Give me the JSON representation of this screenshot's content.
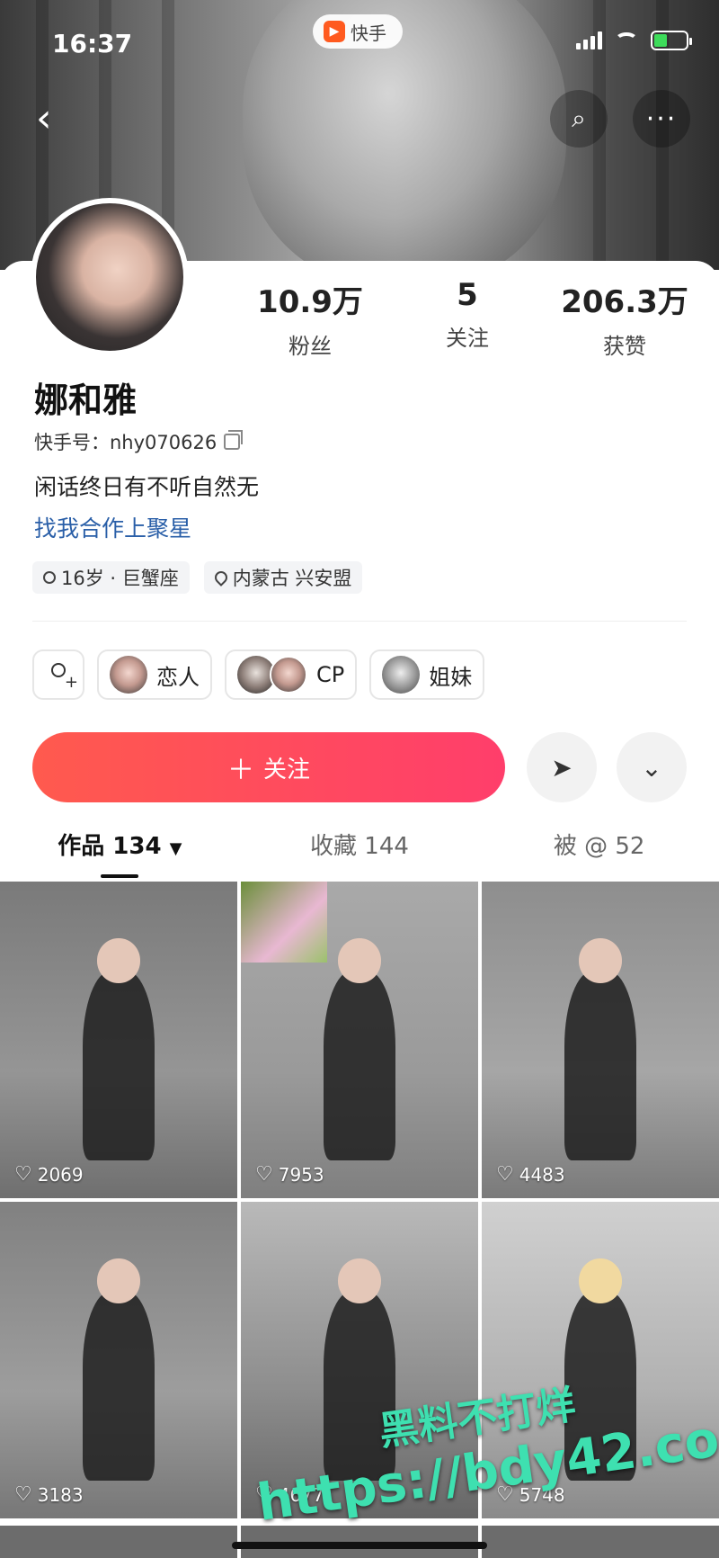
{
  "status": {
    "time": "16:37",
    "app_name": "快手"
  },
  "profile": {
    "name": "娜和雅",
    "kuaishou_id": "快手号：nhy070626",
    "bio": "闲话终日有不听自然无",
    "link": "找我合作上聚星",
    "tags": [
      "16岁 · 巨蟹座",
      "内蒙古 兴安盟"
    ]
  },
  "stats": [
    {
      "num": "10.9万",
      "label": "粉丝"
    },
    {
      "num": "5",
      "label": "关注"
    },
    {
      "num": "206.3万",
      "label": "获赞"
    }
  ],
  "relations": [
    {
      "label": "恋人"
    },
    {
      "label": "CP"
    },
    {
      "label": "姐妹"
    }
  ],
  "actions": {
    "follow": "关注"
  },
  "tabs": [
    {
      "label": "作品 134"
    },
    {
      "label": "收藏 144"
    },
    {
      "label": "被 @ 52"
    }
  ],
  "videos": [
    {
      "likes": "2069"
    },
    {
      "likes": "7953"
    },
    {
      "likes": "4483"
    },
    {
      "likes": "3183"
    },
    {
      "likes": "4677"
    },
    {
      "likes": "5748"
    }
  ],
  "watermark": {
    "line1": "黑料不打烊",
    "line2": "https://bdy42.co"
  },
  "icons": {
    "back": "back-icon",
    "search": "search-icon",
    "more": "more-icon",
    "copy": "copy-icon",
    "share": "send-icon",
    "dropdown": "chevron-down-icon",
    "heart": "heart-icon"
  },
  "colors": {
    "accent": "#ff4660",
    "link": "#2a5fa8",
    "watermark": "#3ee0b0"
  }
}
